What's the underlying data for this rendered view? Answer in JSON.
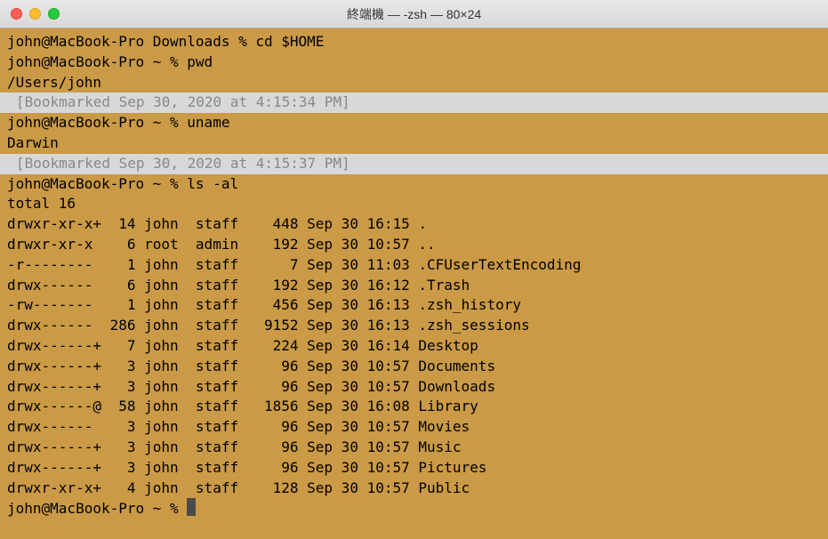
{
  "window": {
    "title": "終端機 — -zsh — 80×24"
  },
  "lines": [
    {
      "type": "normal",
      "text": "john@MacBook-Pro Downloads % cd $HOME"
    },
    {
      "type": "normal",
      "text": "john@MacBook-Pro ~ % pwd"
    },
    {
      "type": "normal",
      "text": "/Users/john"
    },
    {
      "type": "bookmark",
      "text": "[Bookmarked Sep 30, 2020 at 4:15:34 PM]"
    },
    {
      "type": "normal",
      "text": "john@MacBook-Pro ~ % uname"
    },
    {
      "type": "normal",
      "text": "Darwin"
    },
    {
      "type": "bookmark",
      "text": "[Bookmarked Sep 30, 2020 at 4:15:37 PM]"
    },
    {
      "type": "normal",
      "text": "john@MacBook-Pro ~ % ls -al"
    },
    {
      "type": "normal",
      "text": "total 16"
    },
    {
      "type": "normal",
      "text": "drwxr-xr-x+  14 john  staff    448 Sep 30 16:15 ."
    },
    {
      "type": "normal",
      "text": "drwxr-xr-x    6 root  admin    192 Sep 30 10:57 .."
    },
    {
      "type": "normal",
      "text": "-r--------    1 john  staff      7 Sep 30 11:03 .CFUserTextEncoding"
    },
    {
      "type": "normal",
      "text": "drwx------    6 john  staff    192 Sep 30 16:12 .Trash"
    },
    {
      "type": "normal",
      "text": "-rw-------    1 john  staff    456 Sep 30 16:13 .zsh_history"
    },
    {
      "type": "normal",
      "text": "drwx------  286 john  staff   9152 Sep 30 16:13 .zsh_sessions"
    },
    {
      "type": "normal",
      "text": "drwx------+   7 john  staff    224 Sep 30 16:14 Desktop"
    },
    {
      "type": "normal",
      "text": "drwx------+   3 john  staff     96 Sep 30 10:57 Documents"
    },
    {
      "type": "normal",
      "text": "drwx------+   3 john  staff     96 Sep 30 10:57 Downloads"
    },
    {
      "type": "normal",
      "text": "drwx------@  58 john  staff   1856 Sep 30 16:08 Library"
    },
    {
      "type": "normal",
      "text": "drwx------    3 john  staff     96 Sep 30 10:57 Movies"
    },
    {
      "type": "normal",
      "text": "drwx------+   3 john  staff     96 Sep 30 10:57 Music"
    },
    {
      "type": "normal",
      "text": "drwx------+   3 john  staff     96 Sep 30 10:57 Pictures"
    },
    {
      "type": "normal",
      "text": "drwxr-xr-x+   4 john  staff    128 Sep 30 10:57 Public"
    },
    {
      "type": "prompt",
      "text": "john@MacBook-Pro ~ % "
    }
  ]
}
